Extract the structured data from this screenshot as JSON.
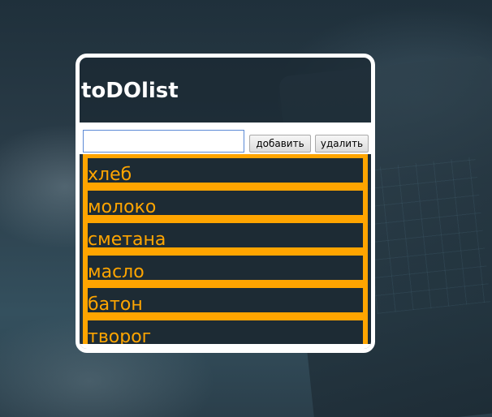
{
  "app": {
    "title": "toDOlist"
  },
  "controls": {
    "input_value": "",
    "input_placeholder": "",
    "add_label": "добавить",
    "delete_label": "удалить"
  },
  "items": [
    {
      "label": "хлеб"
    },
    {
      "label": "молоко"
    },
    {
      "label": "сметана"
    },
    {
      "label": "масло"
    },
    {
      "label": "батон"
    },
    {
      "label": "творог"
    }
  ],
  "colors": {
    "accent": "#ffa500",
    "card_border": "#ffffff",
    "item_background": "#1d2b34"
  }
}
